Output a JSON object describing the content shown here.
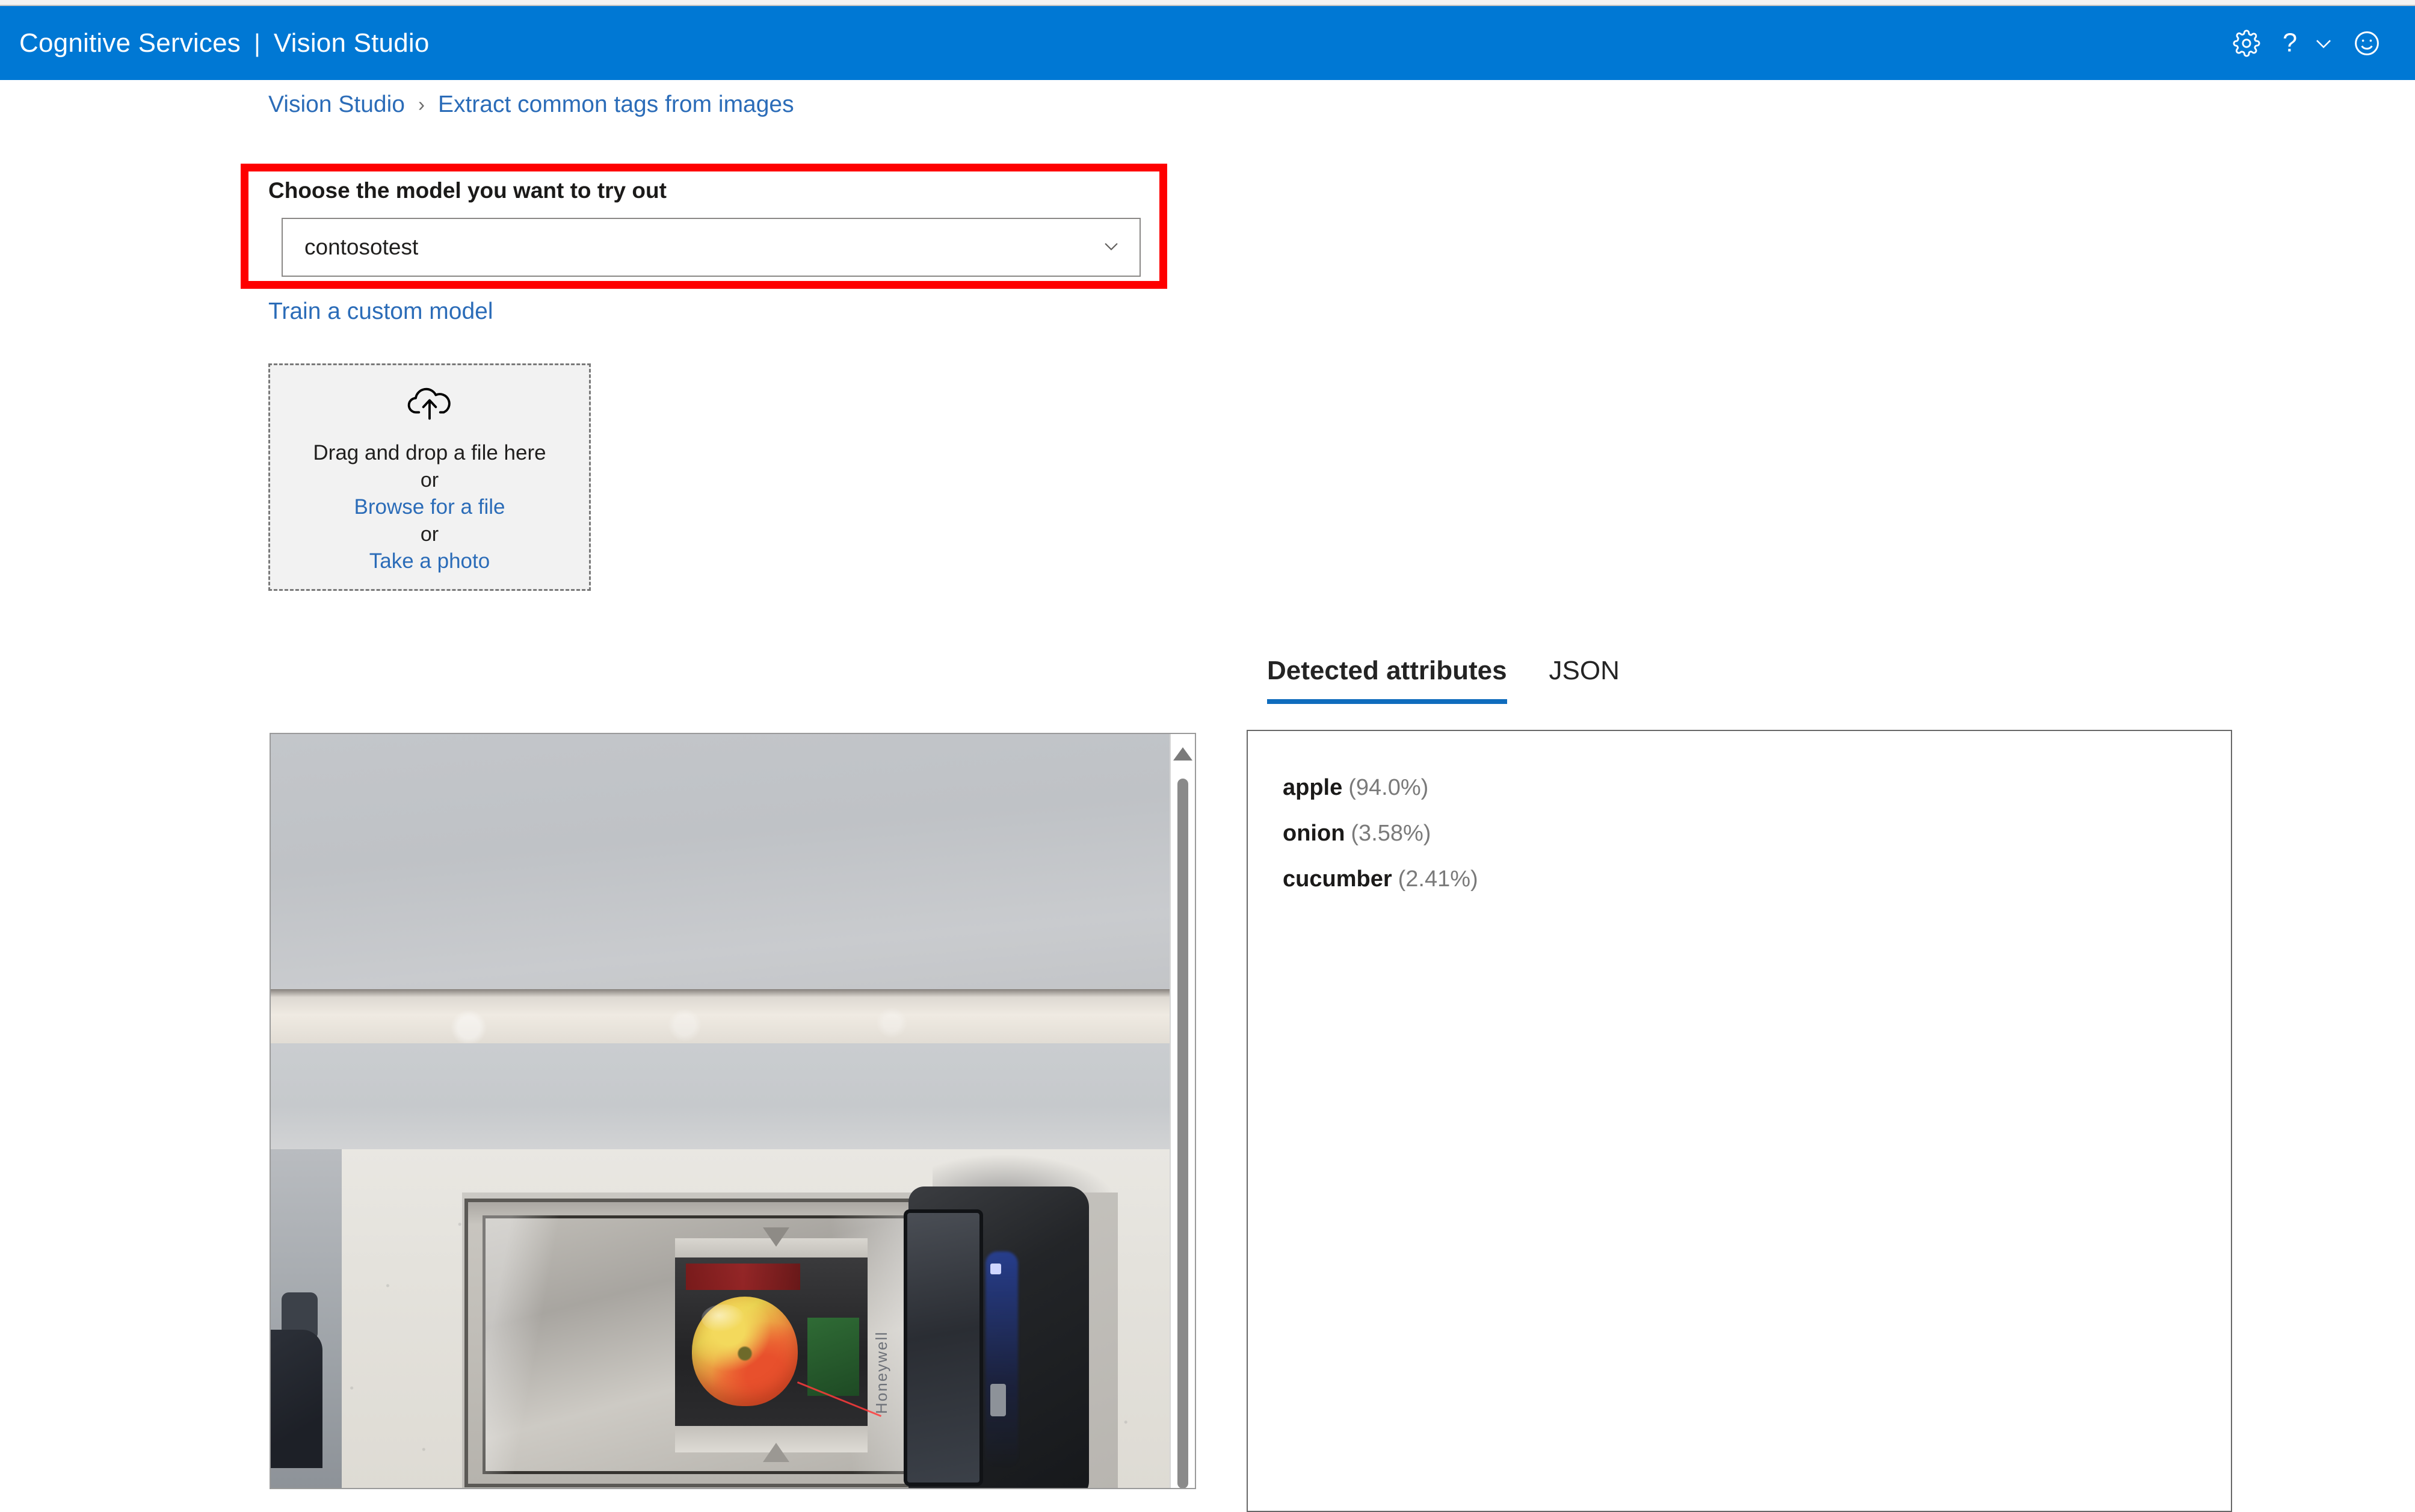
{
  "header": {
    "brand_primary": "Cognitive Services",
    "brand_separator": "|",
    "brand_secondary": "Vision Studio",
    "background_color": "#0078d4",
    "icons": [
      {
        "name": "gear-icon",
        "label": "Settings"
      },
      {
        "name": "question-icon",
        "label": "Help"
      },
      {
        "name": "chevron-down-icon",
        "label": "More"
      },
      {
        "name": "smiley-icon",
        "label": "Feedback"
      }
    ]
  },
  "breadcrumb": {
    "separator": "›",
    "items": [
      {
        "label": "Vision Studio"
      },
      {
        "label": "Extract common tags from images"
      }
    ],
    "link_color": "#2b6cb8"
  },
  "model_section": {
    "highlight_color": "#fe0000",
    "label": "Choose the model you want to try out",
    "select": {
      "value": "contosotest",
      "chevron": "chevron-down-icon"
    },
    "train_link": "Train a custom model"
  },
  "upload": {
    "icon": "cloud-upload-icon",
    "drag_text": "Drag and drop a file here",
    "or_1": "or",
    "browse_link": "Browse for a file",
    "or_2": "or",
    "photo_link": "Take a photo"
  },
  "results": {
    "tabs": [
      {
        "label": "Detected attributes",
        "active": true
      },
      {
        "label": "JSON",
        "active": false
      }
    ],
    "active_tab_underline_color": "#0f6cbd",
    "attributes": [
      {
        "name": "apple",
        "score": "(94.0%)",
        "value": 94.0
      },
      {
        "name": "onion",
        "score": "(3.58%)",
        "value": 3.58
      },
      {
        "name": "cucumber",
        "score": "(2.41%)",
        "value": 2.41
      }
    ]
  },
  "preview": {
    "alt": "Photo of an apple on a barcode scanner scale at a checkout counter",
    "scrollbar": {
      "name": "vertical-scrollbar",
      "position": "top"
    }
  }
}
